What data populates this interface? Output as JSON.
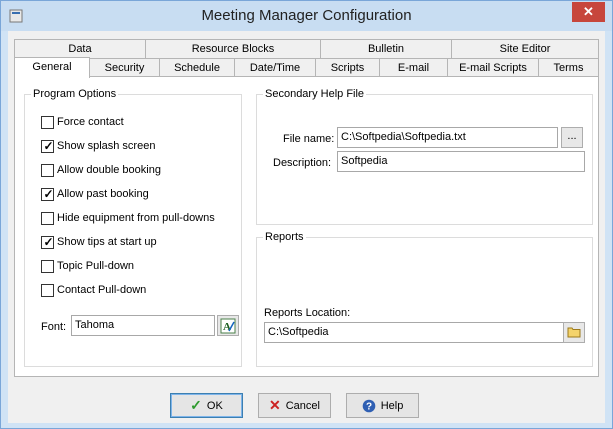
{
  "window": {
    "title": "Meeting Manager Configuration",
    "close_glyph": "✕"
  },
  "tabs_row1": [
    {
      "label": "Data"
    },
    {
      "label": "Resource Blocks"
    },
    {
      "label": "Bulletin"
    },
    {
      "label": "Site Editor"
    }
  ],
  "tabs_row2": [
    {
      "label": "General"
    },
    {
      "label": "Security"
    },
    {
      "label": "Schedule"
    },
    {
      "label": "Date/Time"
    },
    {
      "label": "Scripts"
    },
    {
      "label": "E-mail"
    },
    {
      "label": "E-mail Scripts"
    },
    {
      "label": "Terms"
    }
  ],
  "active_tab": "General",
  "program_options": {
    "title": "Program Options",
    "options": [
      {
        "label": "Force contact",
        "checked": false
      },
      {
        "label": "Show splash screen",
        "checked": true
      },
      {
        "label": "Allow double booking",
        "checked": false
      },
      {
        "label": "Allow past booking",
        "checked": true
      },
      {
        "label": "Hide equipment from pull-downs",
        "checked": false
      },
      {
        "label": "Show tips at start up",
        "checked": true
      },
      {
        "label": "Topic Pull-down",
        "checked": false
      },
      {
        "label": "Contact Pull-down",
        "checked": false
      }
    ],
    "font_label": "Font:",
    "font_value": "Tahoma"
  },
  "help_file": {
    "title": "Secondary Help File",
    "file_name_label": "File name:",
    "file_name_value": "C:\\Softpedia\\Softpedia.txt",
    "browse_label": "...",
    "description_label": "Description:",
    "description_value": "Softpedia"
  },
  "reports": {
    "title": "Reports",
    "location_label": "Reports Location:",
    "location_value": "C:\\Softpedia"
  },
  "buttons": {
    "ok": "OK",
    "cancel": "Cancel",
    "help": "Help"
  },
  "colors": {
    "ok_icon": "#2e9a2e",
    "cancel_icon": "#cc2222",
    "help_icon": "#2f5fb3"
  }
}
